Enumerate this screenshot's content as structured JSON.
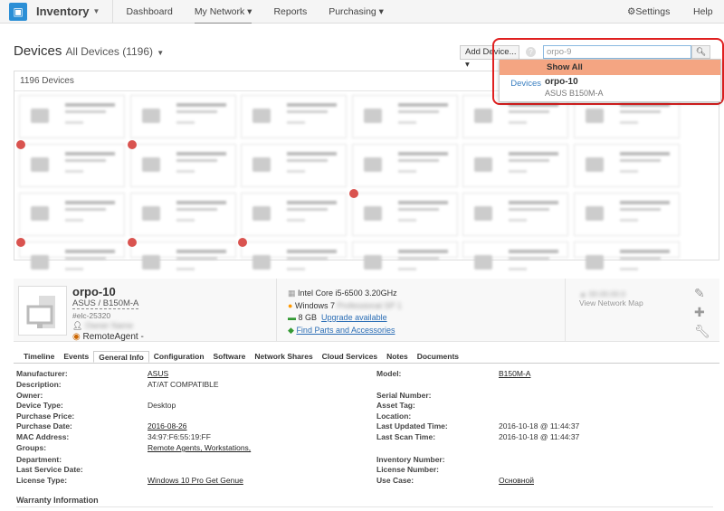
{
  "nav": {
    "app": "Inventory",
    "items": [
      "Dashboard",
      "My Network",
      "Reports",
      "Purchasing"
    ],
    "settings": "Settings",
    "help": "Help"
  },
  "header": {
    "title": "Devices",
    "filter": "All Devices (1196)",
    "add_device": "Add Device...",
    "search_value": "orpo-9"
  },
  "dropdown": {
    "show_all": "Show All",
    "category": "Devices",
    "result_name": "orpo-10",
    "result_sub": "ASUS B150M-A"
  },
  "panel": {
    "count": "1196 Devices"
  },
  "device": {
    "name": "orpo-10",
    "model": "ASUS / B150M-A",
    "id": "#elc-25320",
    "agent": "RemoteAgent -",
    "cpu": "Intel Core i5-6500 3.20GHz",
    "os": "Windows 7",
    "ram": "8 GB",
    "upgrade": "Upgrade available",
    "parts": "Find Parts and Accessories",
    "network_map": "View Network Map"
  },
  "tabs": [
    "Timeline",
    "Events",
    "General Info",
    "Configuration",
    "Software",
    "Network Shares",
    "Cloud Services",
    "Notes",
    "Documents"
  ],
  "info_left": [
    {
      "label": "Manufacturer:",
      "value": "ASUS",
      "link": true
    },
    {
      "label": "Description:",
      "value": "AT/AT COMPATIBLE"
    },
    {
      "label": "Owner:",
      "value": ""
    },
    {
      "label": "Device Type:",
      "value": "Desktop"
    },
    {
      "label": "Purchase Price:",
      "value": ""
    },
    {
      "label": "Purchase Date:",
      "value": "2016-08-26",
      "link": true
    },
    {
      "label": "MAC Address:",
      "value": "34:97:F6:55:19:FF"
    },
    {
      "label": "Groups:",
      "value": "Remote Agents, Workstations,",
      "link": true
    },
    {
      "label": "Department:",
      "value": ""
    },
    {
      "label": "Last Service Date:",
      "value": ""
    },
    {
      "label": "License Type:",
      "value": "Windows 10 Pro Get Genue",
      "link": true
    }
  ],
  "info_right": [
    {
      "label": "Model:",
      "value": "B150M-A",
      "link": true
    },
    {
      "label": "Serial Number:",
      "value": ""
    },
    {
      "label": "Asset Tag:",
      "value": ""
    },
    {
      "label": "Location:",
      "value": ""
    },
    {
      "label": "Last Updated Time:",
      "value": "2016-10-18 @ 11:44:37"
    },
    {
      "label": "Last Scan Time:",
      "value": "2016-10-18 @ 11:44:37"
    },
    {
      "label": "Inventory Number:",
      "value": ""
    },
    {
      "label": "License Number:",
      "value": ""
    },
    {
      "label": "Use Case:",
      "value": "Основной",
      "link": true
    }
  ],
  "warranty": "Warranty Information",
  "colors": {
    "accent": "#2b8fd6",
    "highlight": "#f4a582",
    "callout": "#e02020"
  }
}
